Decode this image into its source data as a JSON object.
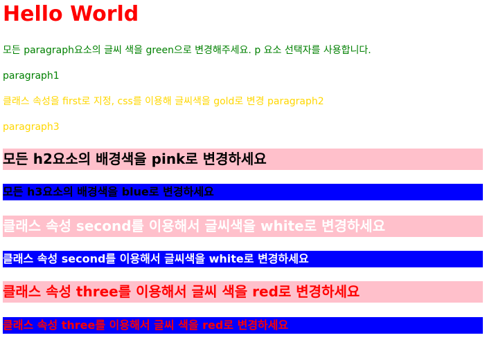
{
  "heading": {
    "text": "Hello World"
  },
  "paragraphs": [
    {
      "text": "모든 paragraph요소의 글씨 색을 green으로 변경해주세요. p 요소 선택자를 사용합니다.",
      "color": "#008000"
    },
    {
      "text": "paragraph1",
      "color": "#008000"
    },
    {
      "text": "클래스 속성을 first로 지정, css를 이용해 글씨색을 gold로 변경 paragraph2",
      "color": "#ffd700"
    },
    {
      "text": "paragraph3",
      "color": "#ffd700"
    }
  ],
  "bars": [
    {
      "level": "h2",
      "text": "모든 h2요소의 배경색을 pink로 변경하세요",
      "bg": "#ffc0cb",
      "color": "#000000"
    },
    {
      "level": "h3",
      "text": "모든 h3요소의 배경색을 blue로 변경하세요",
      "bg": "#0000ff",
      "color": "#000000"
    },
    {
      "level": "h2",
      "text": "클래스 속성 second를 이용해서 글씨색을 white로 변경하세요",
      "bg": "#ffc0cb",
      "color": "#ffffff"
    },
    {
      "level": "h3",
      "text": "클래스 속성 second를 이용해서 글씨색을 white로 변경하세요",
      "bg": "#0000ff",
      "color": "#ffffff"
    },
    {
      "level": "h2",
      "text": "클래스 속성 three를 이용해서 글씨 색을 red로 변경하세요",
      "bg": "#ffc0cb",
      "color": "#ff0000"
    },
    {
      "level": "h3",
      "text": "클래스 속성 three를 이용해서 글씨 색을 red로 변경하세요",
      "bg": "#0000ff",
      "color": "#ff0000"
    }
  ]
}
